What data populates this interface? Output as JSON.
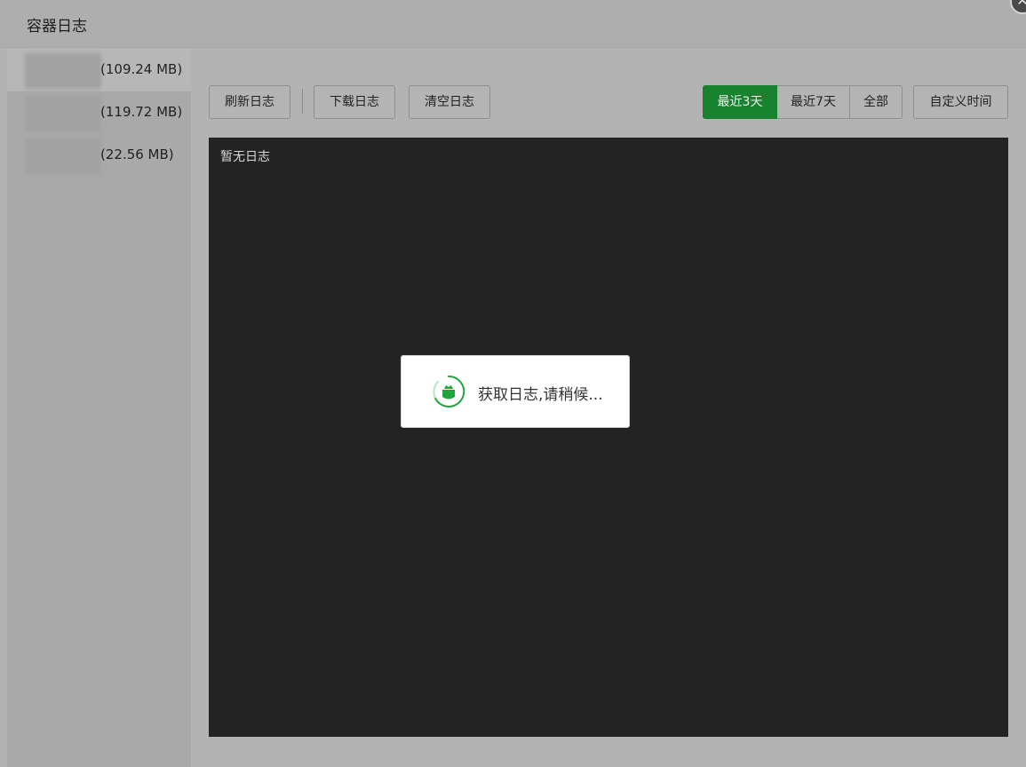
{
  "modal": {
    "title": "容器日志",
    "close_icon": "close-icon"
  },
  "sidebar": {
    "items": [
      {
        "name": "",
        "size": "(109.24 MB)"
      },
      {
        "name": "",
        "size": "(119.72 MB)"
      },
      {
        "name": "",
        "size": "(22.56 MB)"
      }
    ]
  },
  "toolbar": {
    "refresh_label": "刷新日志",
    "download_label": "下载日志",
    "clear_label": "清空日志",
    "ranges": [
      "最近3天",
      "最近7天",
      "全部"
    ],
    "active_range": "最近3天",
    "custom_time_label": "自定义时间"
  },
  "log": {
    "empty_text": "暂无日志"
  },
  "loading": {
    "text": "获取日志,请稍候..."
  },
  "colors": {
    "accent": "#17832e",
    "log_background": "#232323",
    "overlay_gray": "#b3b3b3"
  }
}
